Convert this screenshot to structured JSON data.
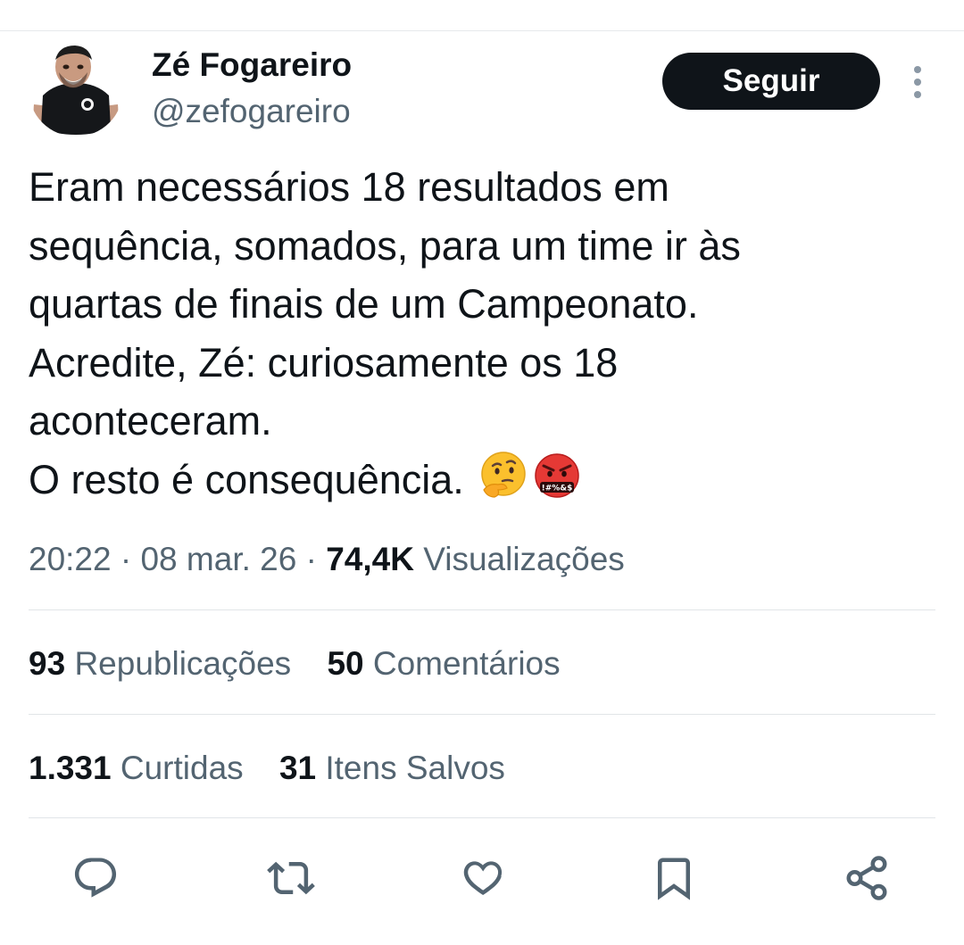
{
  "author": {
    "name": "Zé Fogareiro",
    "handle": "@zefogareiro"
  },
  "follow_label": "Seguir",
  "tweet": {
    "lines": [
      "Eram necessários 18 resultados em",
      "sequência, somados, para um time ir às",
      "quartas de finais de um Campeonato.",
      "Acredite, Zé: curiosamente os 18",
      "aconteceram.",
      "O resto é consequência."
    ],
    "emojis": [
      "thinking-face-emoji",
      "face-with-symbols-on-mouth-emoji"
    ]
  },
  "meta": {
    "time": "20:22",
    "date": "08 mar. 26",
    "views_count": "74,4K",
    "views_label": "Visualizações"
  },
  "stats": {
    "reposts_count": "93",
    "reposts_label": "Republicações",
    "comments_count": "50",
    "comments_label": "Comentários",
    "likes_count": "1.331",
    "likes_label": "Curtidas",
    "saves_count": "31",
    "saves_label": "Itens Salvos"
  },
  "actions": [
    "reply-icon",
    "repost-icon",
    "like-icon",
    "bookmark-icon",
    "share-icon"
  ],
  "colors": {
    "text": "#0f1419",
    "secondary": "#536471",
    "button_bg": "#0f1419",
    "divider": "#e1e5e8"
  }
}
